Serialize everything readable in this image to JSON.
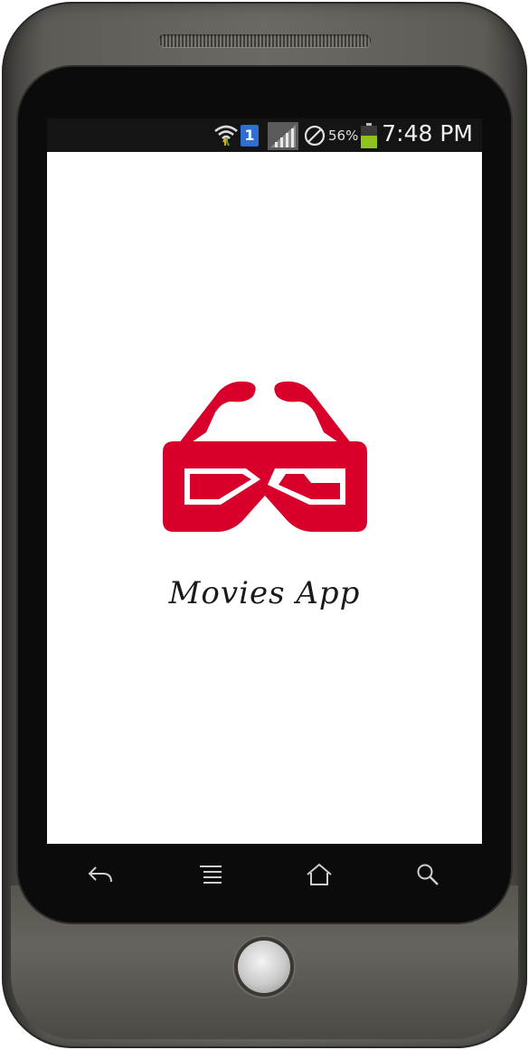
{
  "status_bar": {
    "sim_slot": "1",
    "battery_percent": "56%",
    "battery_level": 0.56,
    "time": "7:48 PM",
    "icons": [
      "wifi-icon",
      "sim-card-icon",
      "signal-icon",
      "do-not-disturb-icon",
      "battery-icon"
    ]
  },
  "splash": {
    "title": "Movies App",
    "logo_icon": "3d-glasses-icon",
    "logo_color": "#d8002a"
  },
  "nav_bar": {
    "buttons": [
      "back-icon",
      "menu-icon",
      "home-icon",
      "search-icon"
    ]
  },
  "colors": {
    "screen_bg": "#ffffff",
    "status_bar_bg": "#141414",
    "accent": "#d8002a"
  }
}
